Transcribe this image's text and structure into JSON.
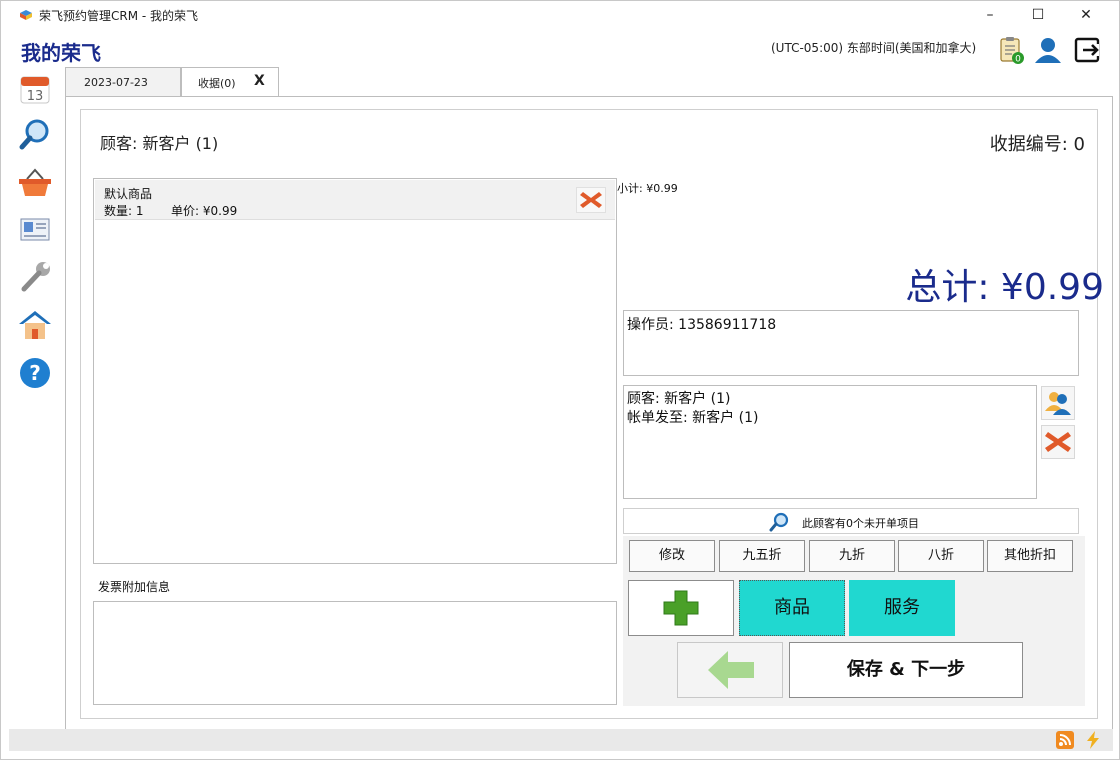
{
  "window": {
    "title": "荣飞预约管理CRM - 我的荣飞",
    "controls": {
      "minimize": "–",
      "maximize": "☐",
      "close": "✕"
    }
  },
  "header": {
    "app_name": "我的荣飞",
    "timezone": "(UTC-05:00) 东部时间(美国和加拿大)",
    "notes_badge": "0",
    "icons": [
      "clipboard-icon",
      "user-icon",
      "logout-icon"
    ]
  },
  "sidebar": {
    "calendar_day": "13",
    "items": [
      "calendar-icon",
      "search-icon",
      "basket-icon",
      "contact-card-icon",
      "wrench-icon",
      "home-icon",
      "help-icon"
    ]
  },
  "tabs": [
    {
      "label": "2023-07-23"
    },
    {
      "label": "收据(0)",
      "close": "X"
    }
  ],
  "receipt": {
    "customer": "顾客: 新客户 (1)",
    "number": "收据编号: 0",
    "items": [
      {
        "name": "默认商品",
        "qty": "数量: 1",
        "price": "单价: ¥0.99"
      }
    ],
    "invoice_label": "发票附加信息",
    "invoice_text": "",
    "subtotal": "小计: ¥0.99",
    "total": "总计: ¥0.99",
    "operator": "操作员: 13586911718",
    "client_customer": "顾客: 新客户 (1)",
    "bill_to": "帐单发至: 新客户 (1)",
    "open_items": "此顾客有0个未开单项目"
  },
  "actions": {
    "discounts": [
      "修改",
      "九五折",
      "九折",
      "八折",
      "其他折扣"
    ],
    "goods": "商品",
    "service": "服务",
    "save": "保存 & 下一步"
  },
  "colors": {
    "accent_cyan": "#20d8d0",
    "title_blue": "#1a2b8c",
    "delete_red": "#e0502a",
    "add_green": "#4aa028"
  }
}
